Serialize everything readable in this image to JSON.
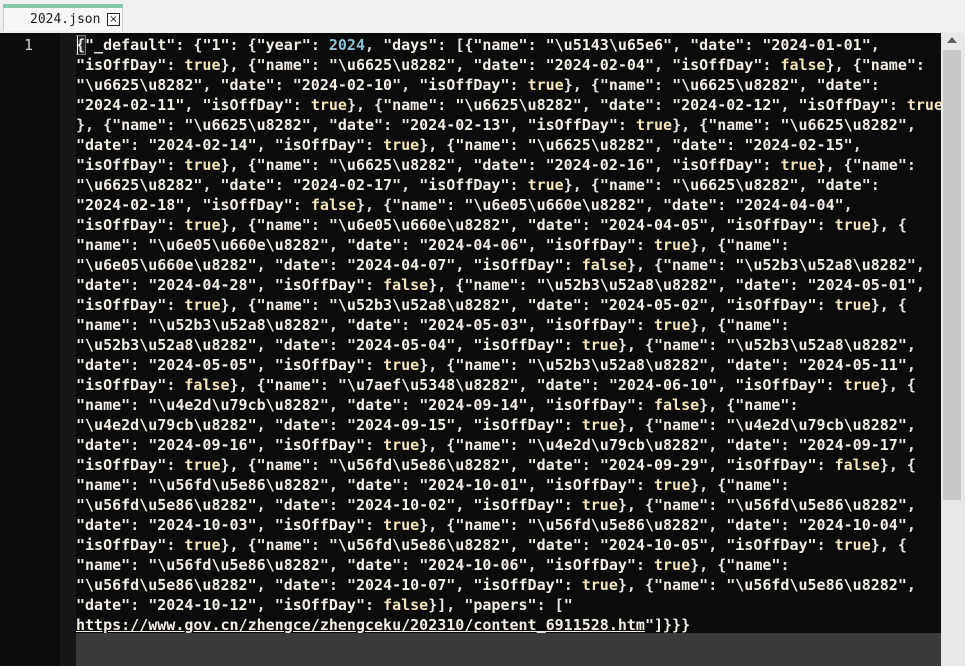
{
  "tab": {
    "label": "2024.json",
    "close_glyph": "×"
  },
  "gutter": {
    "line_number": "1"
  },
  "editor": {
    "lines": [
      "{\"_default\": {\"1\": {\"year\": 2024, \"days\": [{\"name\": \"\\u5143\\u65e6\", \"date\": \"2024-01-01\",",
      "\"isOffDay\": true}, {\"name\": \"\\u6625\\u8282\", \"date\": \"2024-02-04\", \"isOffDay\": false}, {\"name\":",
      "\"\\u6625\\u8282\", \"date\": \"2024-02-10\", \"isOffDay\": true}, {\"name\": \"\\u6625\\u8282\", \"date\":",
      "\"2024-02-11\", \"isOffDay\": true}, {\"name\": \"\\u6625\\u8282\", \"date\": \"2024-02-12\", \"isOffDay\": true",
      "}, {\"name\": \"\\u6625\\u8282\", \"date\": \"2024-02-13\", \"isOffDay\": true}, {\"name\": \"\\u6625\\u8282\",",
      "\"date\": \"2024-02-14\", \"isOffDay\": true}, {\"name\": \"\\u6625\\u8282\", \"date\": \"2024-02-15\",",
      "\"isOffDay\": true}, {\"name\": \"\\u6625\\u8282\", \"date\": \"2024-02-16\", \"isOffDay\": true}, {\"name\":",
      "\"\\u6625\\u8282\", \"date\": \"2024-02-17\", \"isOffDay\": true}, {\"name\": \"\\u6625\\u8282\", \"date\":",
      "\"2024-02-18\", \"isOffDay\": false}, {\"name\": \"\\u6e05\\u660e\\u8282\", \"date\": \"2024-04-04\",",
      "\"isOffDay\": true}, {\"name\": \"\\u6e05\\u660e\\u8282\", \"date\": \"2024-04-05\", \"isOffDay\": true}, {",
      "\"name\": \"\\u6e05\\u660e\\u8282\", \"date\": \"2024-04-06\", \"isOffDay\": true}, {\"name\":",
      "\"\\u6e05\\u660e\\u8282\", \"date\": \"2024-04-07\", \"isOffDay\": false}, {\"name\": \"\\u52b3\\u52a8\\u8282\",",
      "\"date\": \"2024-04-28\", \"isOffDay\": false}, {\"name\": \"\\u52b3\\u52a8\\u8282\", \"date\": \"2024-05-01\",",
      "\"isOffDay\": true}, {\"name\": \"\\u52b3\\u52a8\\u8282\", \"date\": \"2024-05-02\", \"isOffDay\": true}, {",
      "\"name\": \"\\u52b3\\u52a8\\u8282\", \"date\": \"2024-05-03\", \"isOffDay\": true}, {\"name\":",
      "\"\\u52b3\\u52a8\\u8282\", \"date\": \"2024-05-04\", \"isOffDay\": true}, {\"name\": \"\\u52b3\\u52a8\\u8282\",",
      "\"date\": \"2024-05-05\", \"isOffDay\": true}, {\"name\": \"\\u52b3\\u52a8\\u8282\", \"date\": \"2024-05-11\",",
      "\"isOffDay\": false}, {\"name\": \"\\u7aef\\u5348\\u8282\", \"date\": \"2024-06-10\", \"isOffDay\": true}, {",
      "\"name\": \"\\u4e2d\\u79cb\\u8282\", \"date\": \"2024-09-14\", \"isOffDay\": false}, {\"name\":",
      "\"\\u4e2d\\u79cb\\u8282\", \"date\": \"2024-09-15\", \"isOffDay\": true}, {\"name\": \"\\u4e2d\\u79cb\\u8282\",",
      "\"date\": \"2024-09-16\", \"isOffDay\": true}, {\"name\": \"\\u4e2d\\u79cb\\u8282\", \"date\": \"2024-09-17\",",
      "\"isOffDay\": true}, {\"name\": \"\\u56fd\\u5e86\\u8282\", \"date\": \"2024-09-29\", \"isOffDay\": false}, {",
      "\"name\": \"\\u56fd\\u5e86\\u8282\", \"date\": \"2024-10-01\", \"isOffDay\": true}, {\"name\":",
      "\"\\u56fd\\u5e86\\u8282\", \"date\": \"2024-10-02\", \"isOffDay\": true}, {\"name\": \"\\u56fd\\u5e86\\u8282\",",
      "\"date\": \"2024-10-03\", \"isOffDay\": true}, {\"name\": \"\\u56fd\\u5e86\\u8282\", \"date\": \"2024-10-04\",",
      "\"isOffDay\": true}, {\"name\": \"\\u56fd\\u5e86\\u8282\", \"date\": \"2024-10-05\", \"isOffDay\": true}, {",
      "\"name\": \"\\u56fd\\u5e86\\u8282\", \"date\": \"2024-10-06\", \"isOffDay\": true}, {\"name\":",
      "\"\\u56fd\\u5e86\\u8282\", \"date\": \"2024-10-07\", \"isOffDay\": true}, {\"name\": \"\\u56fd\\u5e86\\u8282\",",
      "\"date\": \"2024-10-12\", \"isOffDay\": false}], \"papers\": [\"",
      "https://www.gov.cn/zhengce/zhengceku/202310/content_6911528.htm\"]}}}"
    ]
  },
  "colors": {
    "tab_accent": "#86c6aa",
    "editor_background": "#0b0b0b",
    "number": "#8fc3d9",
    "boolean": "#f3e5b8"
  }
}
